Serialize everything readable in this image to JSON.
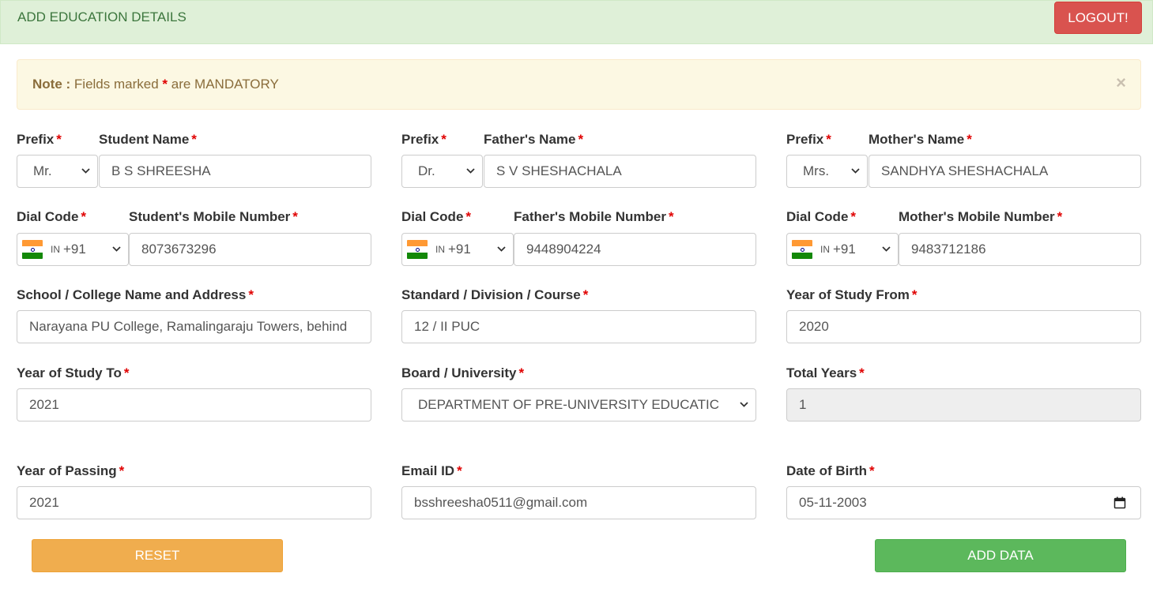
{
  "header": {
    "title": "ADD EDUCATION DETAILS",
    "logout_label": "LOGOUT!"
  },
  "alert": {
    "note_label": "Note :",
    "text_before": "Fields marked",
    "asterisk": "*",
    "text_after": "are MANDATORY",
    "close": "×"
  },
  "row1": {
    "student": {
      "prefix_label": "Prefix",
      "prefix_value": "Mr.",
      "name_label": "Student Name",
      "name_value": "B S SHREESHA"
    },
    "father": {
      "prefix_label": "Prefix",
      "prefix_value": "Dr.",
      "name_label": "Father's Name",
      "name_value": "S V SHESHACHALA"
    },
    "mother": {
      "prefix_label": "Prefix",
      "prefix_value": "Mrs.",
      "name_label": "Mother's Name",
      "name_value": "SANDHYA SHESHACHALA"
    }
  },
  "row2": {
    "student": {
      "dial_label": "Dial Code",
      "country_code": "IN",
      "dial_value": "+91",
      "mobile_label": "Student's Mobile Number",
      "mobile_value": "8073673296"
    },
    "father": {
      "dial_label": "Dial Code",
      "country_code": "IN",
      "dial_value": "+91",
      "mobile_label": "Father's Mobile Number",
      "mobile_value": "9448904224"
    },
    "mother": {
      "dial_label": "Dial Code",
      "country_code": "IN",
      "dial_value": "+91",
      "mobile_label": "Mother's Mobile Number",
      "mobile_value": "9483712186"
    }
  },
  "row3": {
    "school": {
      "label": "School / College Name and Address",
      "value": "Narayana PU College, Ramalingaraju Towers, behind"
    },
    "standard": {
      "label": "Standard / Division / Course",
      "value": "12 / II PUC"
    },
    "year_from": {
      "label": "Year of Study From",
      "value": "2020"
    }
  },
  "row4": {
    "year_to": {
      "label": "Year of Study To",
      "value": "2021"
    },
    "board": {
      "label": "Board / University",
      "value": "DEPARTMENT OF PRE-UNIVERSITY EDUCATIC"
    },
    "total_years": {
      "label": "Total Years",
      "value": "1"
    }
  },
  "row5": {
    "year_passing": {
      "label": "Year of Passing",
      "value": "2021"
    },
    "email": {
      "label": "Email ID",
      "value": "bsshreesha0511@gmail.com"
    },
    "dob": {
      "label": "Date of Birth",
      "value": "05-11-2003"
    }
  },
  "buttons": {
    "reset": "RESET",
    "add": "ADD DATA"
  },
  "icons": {
    "flag": "india-flag-icon",
    "chevron": "chevron-down-icon",
    "calendar": "calendar-icon",
    "close": "close-icon"
  },
  "colors": {
    "header_bg": "#dff0d8",
    "logout": "#d9534f",
    "alert_bg": "#fcf8e3",
    "required": "#e00000",
    "reset": "#f0ad4e",
    "add": "#5cb85c"
  }
}
